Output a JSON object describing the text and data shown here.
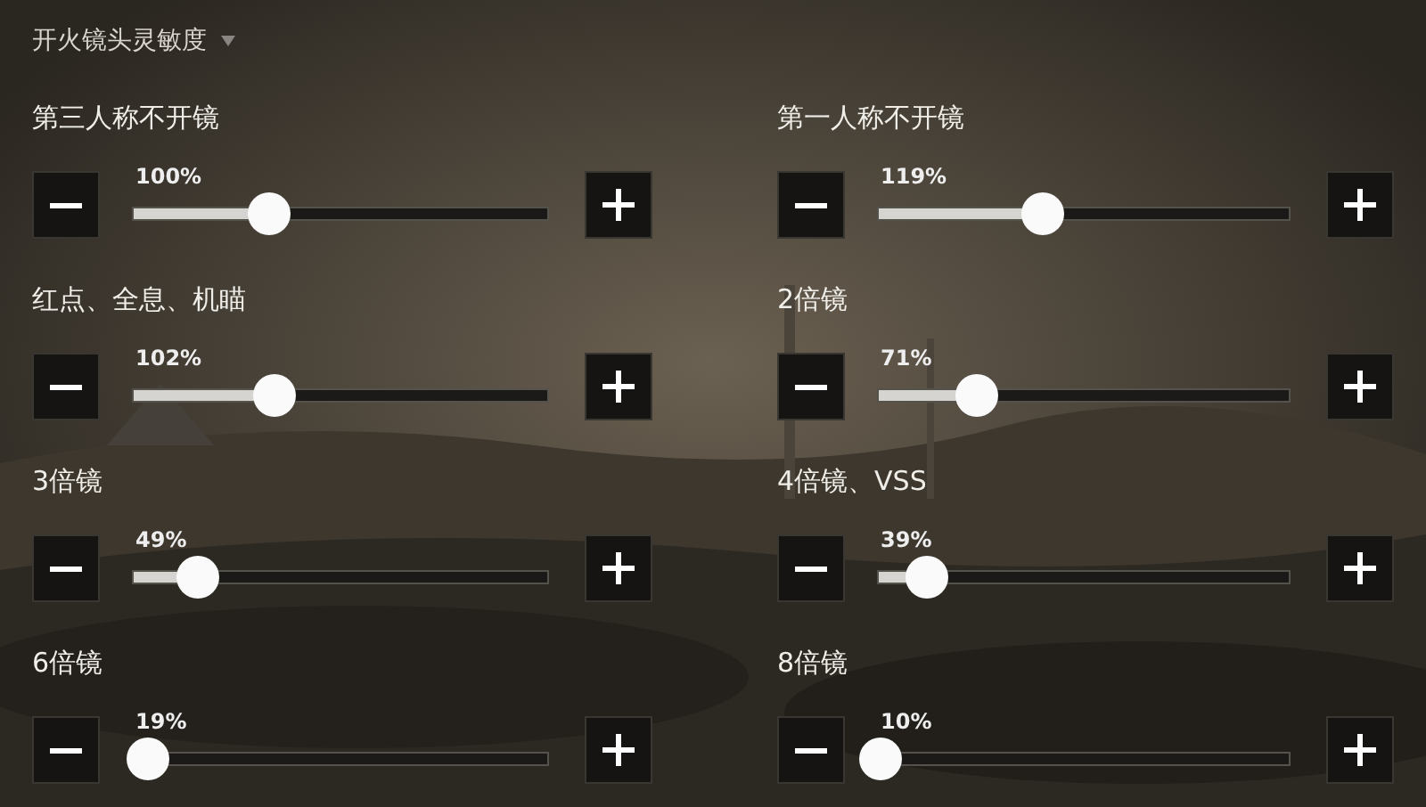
{
  "title": "开火镜头灵敏度",
  "settings": [
    {
      "label": "第三人称不开镜",
      "reading": "100%",
      "level": 0.33
    },
    {
      "label": "第一人称不开镜",
      "reading": "119%",
      "level": 0.4
    },
    {
      "label": "红点、全息、机瞄",
      "reading": "102%",
      "level": 0.34
    },
    {
      "label": "2倍镜",
      "reading": "71%",
      "level": 0.24
    },
    {
      "label": "3倍镜",
      "reading": "49%",
      "level": 0.16
    },
    {
      "label": "4倍镜、VSS",
      "reading": "39%",
      "level": 0.12
    },
    {
      "label": "6倍镜",
      "reading": "19%",
      "level": 0.04
    },
    {
      "label": "8倍镜",
      "reading": "10%",
      "level": 0.01
    }
  ]
}
